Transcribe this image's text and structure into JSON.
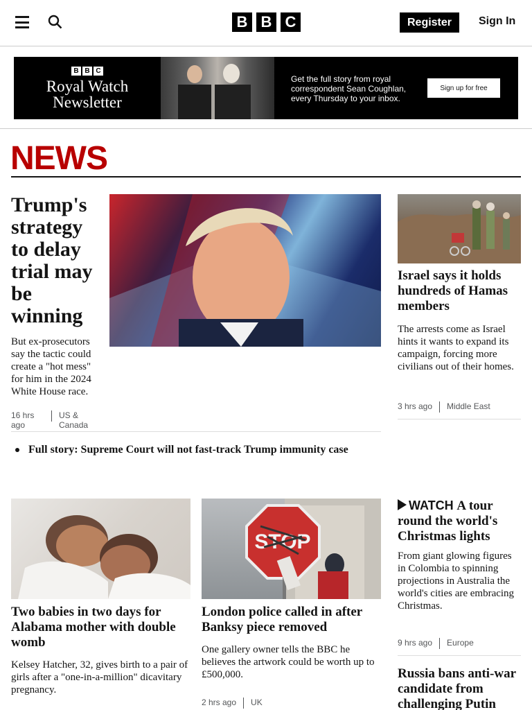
{
  "header": {
    "logo_letters": [
      "B",
      "B",
      "C"
    ],
    "register_label": "Register",
    "signin_label": "Sign In"
  },
  "banner": {
    "logo_letters": [
      "B",
      "B",
      "C"
    ],
    "title_line1": "Royal Watch",
    "title_line2": "Newsletter",
    "text": "Get the full story from royal correspondent Sean Coughlan, every Thursday to your inbox.",
    "signup_label": "Sign up for free"
  },
  "section_title": "NEWS",
  "lead": {
    "headline": "Trump's strategy to delay trial may be winning",
    "summary": "But ex-prosecutors say the tactic could create a \"hot mess\" for him in the 2024 White House race.",
    "time": "16 hrs ago",
    "section": "US & Canada",
    "related": "Full story: Supreme Court will not fast-track Trump immunity case"
  },
  "israel": {
    "headline": "Israel says it holds hundreds of Hamas members",
    "summary": "The arrests come as Israel hints it wants to expand its campaign, forcing more civilians out of their homes.",
    "time": "3 hrs ago",
    "section": "Middle East"
  },
  "babies": {
    "headline": "Two babies in two days for Alabama mother with double womb",
    "summary": "Kelsey Hatcher, 32, gives birth to a pair of girls after a \"one-in-a-million\" dicavitary pregnancy."
  },
  "banksy": {
    "headline": "London police called in after Banksy piece removed",
    "summary": "One gallery owner tells the BBC he believes the artwork could be worth up to £500,000.",
    "time": "2 hrs ago",
    "section": "UK"
  },
  "lights": {
    "watch_label": "WATCH",
    "headline": "A tour round the world's Christmas lights",
    "summary": "From giant glowing figures in Colombia to spinning projections in Australia the world's cities are embracing Christmas.",
    "time": "9 hrs ago",
    "section": "Europe"
  },
  "russia": {
    "headline": "Russia bans anti-war candidate from challenging Putin"
  },
  "colors": {
    "news_red": "#b80000",
    "text": "#141414",
    "meta": "#545658"
  }
}
